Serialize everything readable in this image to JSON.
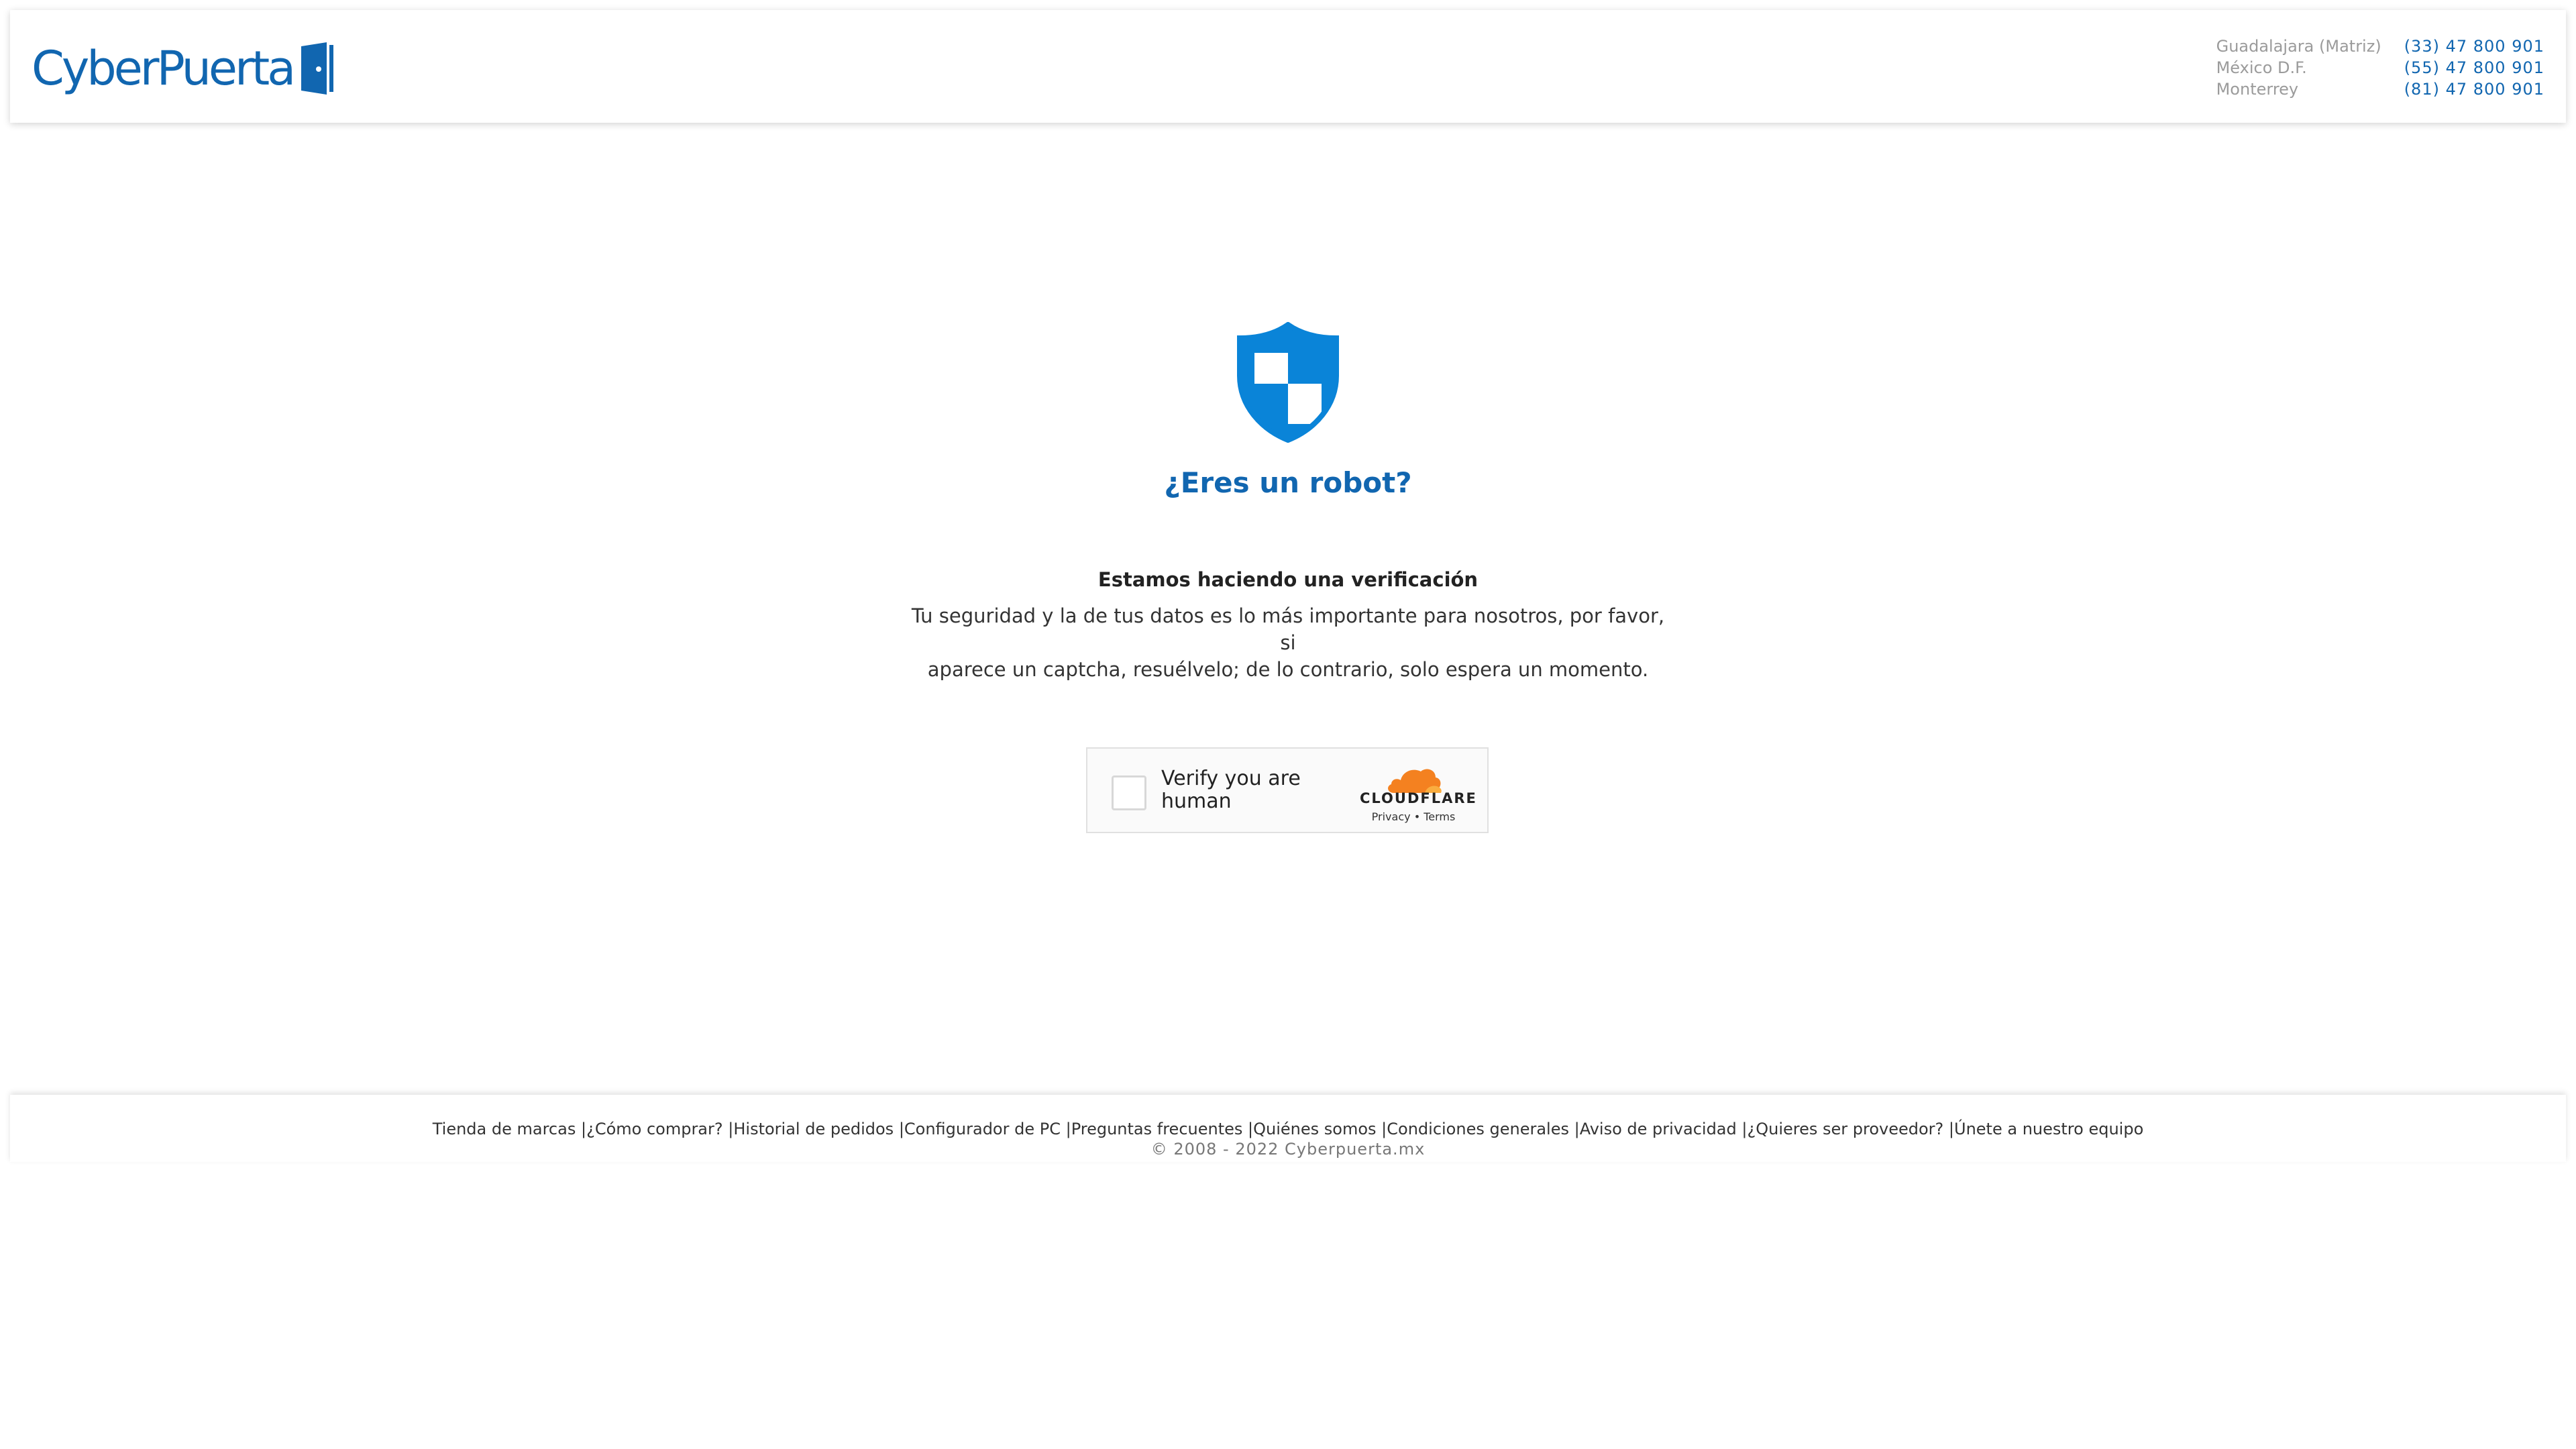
{
  "header": {
    "logo_text": "CyberPuerta",
    "contacts": [
      {
        "city": "Guadalajara (Matriz)",
        "phone": "(33) 47 800 901"
      },
      {
        "city": "México D.F.",
        "phone": "(55) 47 800 901"
      },
      {
        "city": "Monterrey",
        "phone": "(81) 47 800 901"
      }
    ]
  },
  "main": {
    "title": "¿Eres un robot?",
    "subtitle": "Estamos haciendo una verificación",
    "description_line1": "Tu seguridad y la de tus datos es lo más importante para nosotros, por favor, si",
    "description_line2": "aparece un captcha, resuélvelo; de lo contrario, solo espera un momento."
  },
  "captcha": {
    "label": "Verify you are human",
    "provider": "CLOUDFLARE",
    "privacy_link": "Privacy",
    "terms_link": "Terms",
    "separator": "•"
  },
  "footer": {
    "links": [
      "Tienda de marcas",
      "¿Cómo comprar?",
      "Historial de pedidos",
      "Configurador de PC",
      "Preguntas frecuentes",
      "Quiénes somos",
      "Condiciones generales",
      "Aviso de privacidad",
      "¿Quieres ser proveedor?",
      "Únete a nuestro equipo"
    ],
    "copyright": "© 2008 - 2022 Cyberpuerta.mx"
  },
  "colors": {
    "brand_blue": "#1166b0",
    "shield_blue": "#0a84d8",
    "cloudflare_orange": "#f48120"
  }
}
